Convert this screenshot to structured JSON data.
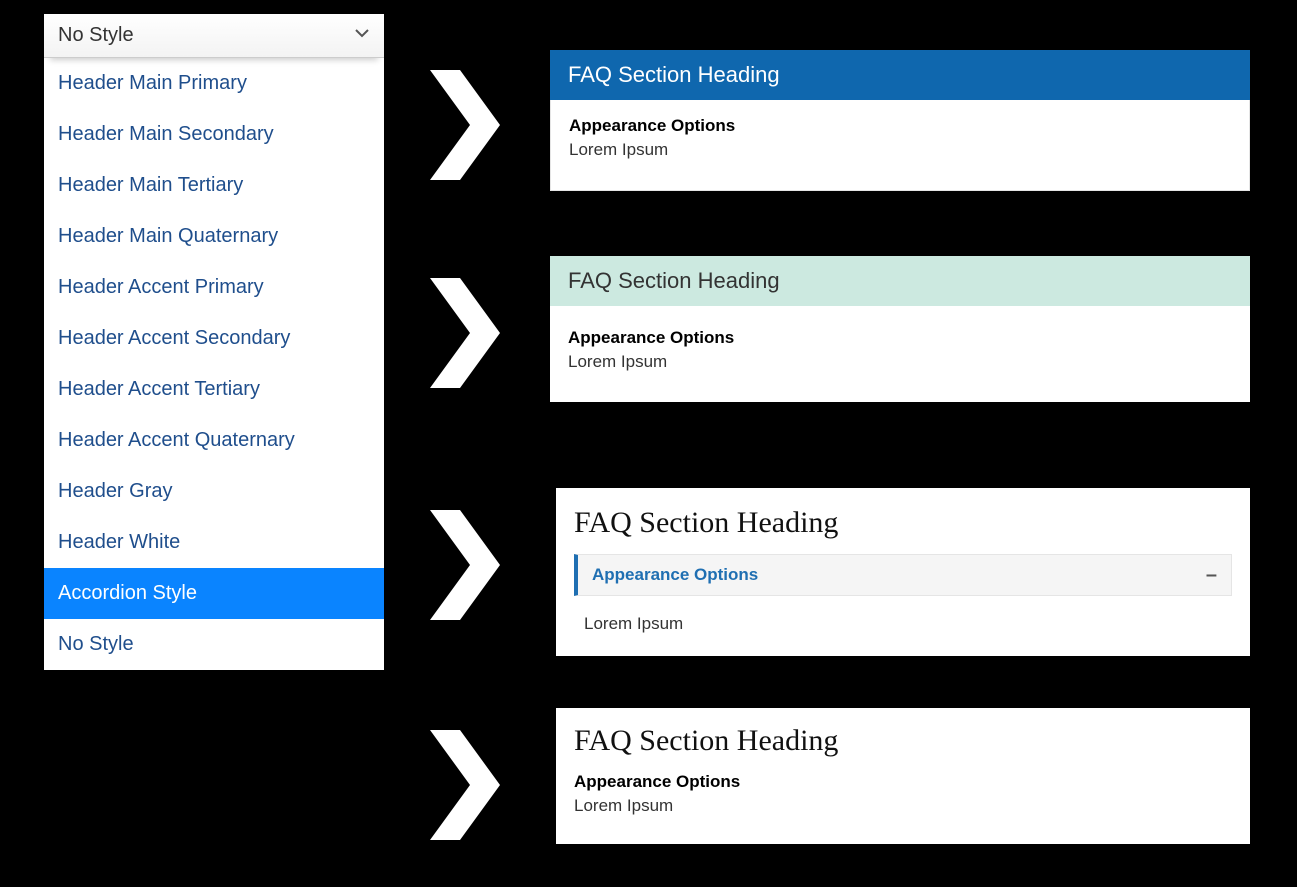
{
  "dropdown": {
    "selected": "No Style",
    "options": [
      "Header Main Primary",
      "Header Main Secondary",
      "Header Main Tertiary",
      "Header Main Quaternary",
      "Header Accent Primary",
      "Header Accent Secondary",
      "Header Accent Tertiary",
      "Header Accent Quaternary",
      "Header Gray",
      "Header White",
      "Accordion Style",
      "No Style"
    ],
    "highlighted_index": 10
  },
  "previews": [
    {
      "heading": "FAQ Section Heading",
      "subheading": "Appearance Options",
      "body": "Lorem Ipsum"
    },
    {
      "heading": "FAQ Section Heading",
      "subheading": "Appearance Options",
      "body": "Lorem Ipsum"
    },
    {
      "heading": "FAQ Section Heading",
      "subheading": "Appearance Options",
      "body": "Lorem Ipsum",
      "collapse_glyph": "–"
    },
    {
      "heading": "FAQ Section Heading",
      "subheading": "Appearance Options",
      "body": "Lorem Ipsum"
    }
  ]
}
